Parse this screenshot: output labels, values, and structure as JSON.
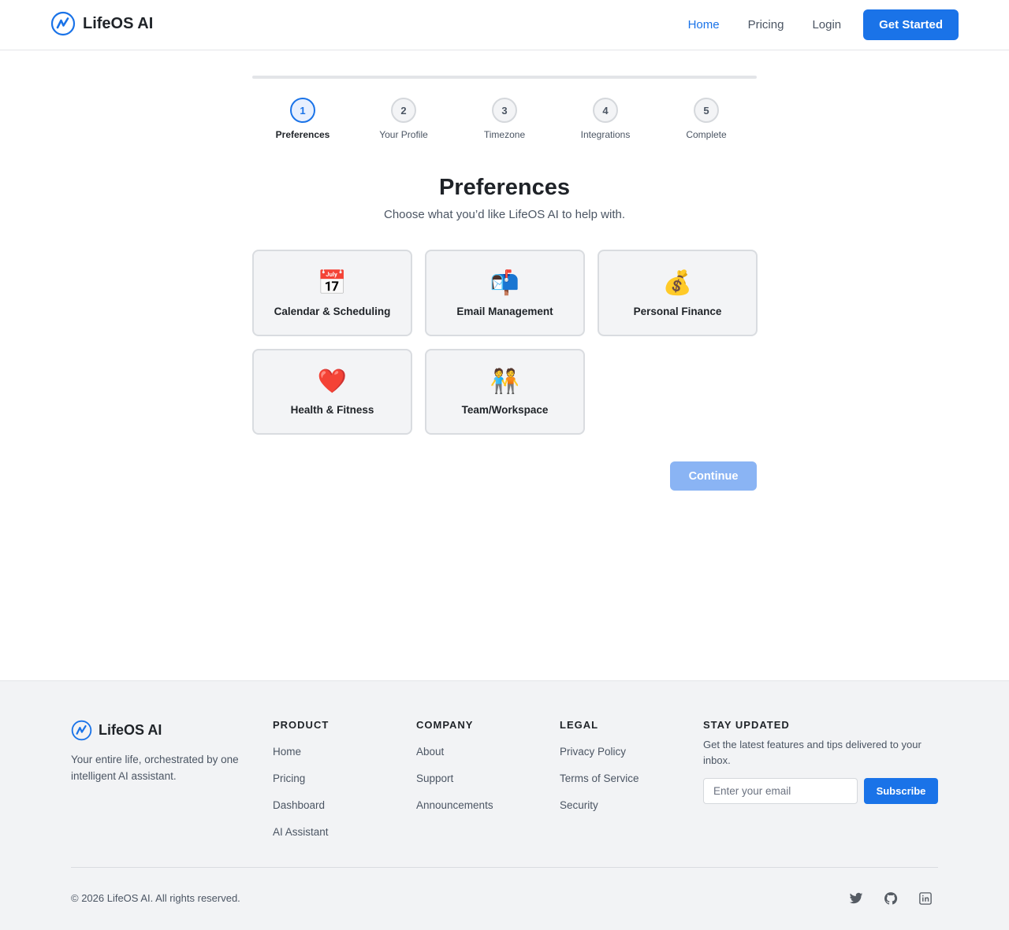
{
  "header": {
    "brand": "LifeOS AI",
    "nav": [
      {
        "label": "Home",
        "active": true
      },
      {
        "label": "Pricing",
        "active": false
      },
      {
        "label": "Login",
        "active": false
      }
    ],
    "cta": "Get Started"
  },
  "stepper": {
    "current_step": 1,
    "steps": [
      {
        "number": "1",
        "label": "Preferences"
      },
      {
        "number": "2",
        "label": "Your Profile"
      },
      {
        "number": "3",
        "label": "Timezone"
      },
      {
        "number": "4",
        "label": "Integrations"
      },
      {
        "number": "5",
        "label": "Complete"
      }
    ]
  },
  "main": {
    "title": "Preferences",
    "subtitle": "Choose what you’d like LifeOS AI to help with.",
    "options": [
      {
        "icon": "📅",
        "icon_name": "calendar-icon",
        "label": "Calendar & Scheduling"
      },
      {
        "icon": "📬",
        "icon_name": "mailbox-icon",
        "label": "Email Management"
      },
      {
        "icon": "💰",
        "icon_name": "money-bag-icon",
        "label": "Personal Finance"
      },
      {
        "icon": "❤️",
        "icon_name": "heart-icon",
        "label": "Health & Fitness"
      },
      {
        "icon": "🧑‍🤝‍🧑",
        "icon_name": "people-icon",
        "label": "Team/Workspace"
      }
    ],
    "continue_label": "Continue"
  },
  "footer": {
    "brand": "LifeOS AI",
    "tagline": "Your entire life, orchestrated by one intelligent AI assistant.",
    "product": {
      "heading": "PRODUCT",
      "links": [
        "Home",
        "Pricing",
        "Dashboard",
        "AI Assistant"
      ]
    },
    "company": {
      "heading": "COMPANY",
      "links": [
        "About",
        "Support",
        "Announcements"
      ]
    },
    "legal": {
      "heading": "LEGAL",
      "links": [
        "Privacy Policy",
        "Terms of Service",
        "Security"
      ]
    },
    "newsletter": {
      "heading": "STAY UPDATED",
      "text": "Get the latest features and tips delivered to your inbox.",
      "placeholder": "Enter your email",
      "button": "Subscribe"
    },
    "copyright": "© 2026 LifeOS AI. All rights reserved.",
    "socials": [
      "twitter-icon",
      "github-icon",
      "linkedin-icon"
    ]
  },
  "colors": {
    "accent": "#1a73e8",
    "accent_disabled": "#8ab4f4",
    "footer_bg": "#f2f3f5"
  }
}
